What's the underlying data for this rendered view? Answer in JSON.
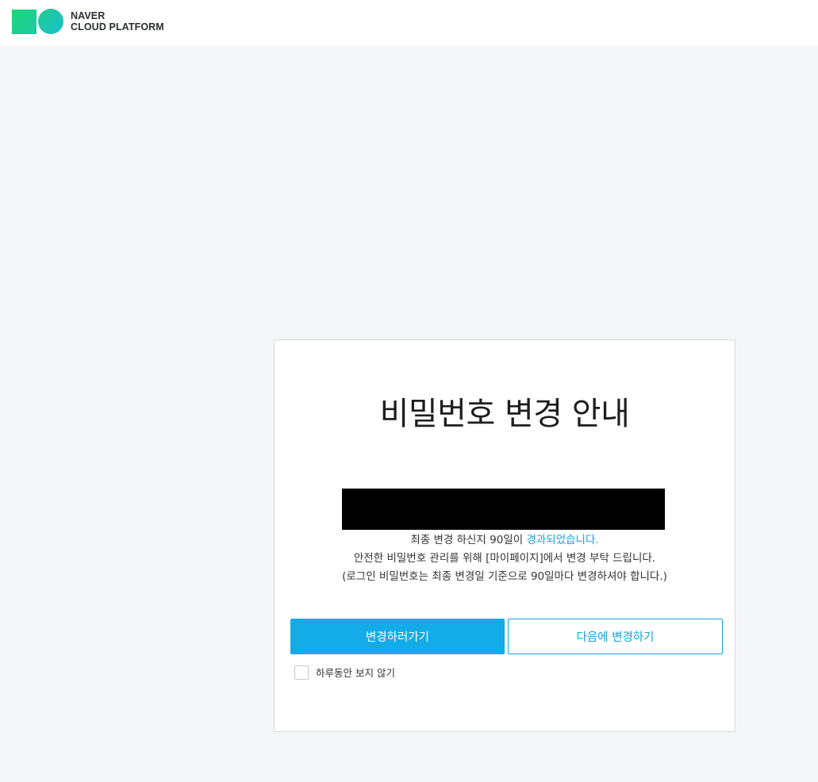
{
  "brand": {
    "line1": "NAVER",
    "line2": "CLOUD PLATFORM",
    "colors": {
      "green": "#1fd67a",
      "teal": "#18c2cf"
    }
  },
  "dialog": {
    "title": "비밀번호 변경 안내",
    "message_line1_prefix": "최종 변경 하신지 90일이 ",
    "message_line1_highlight": "경과되었습니다.",
    "message_line2": "안전한 비밀번호 관리를 위해 [마이페이지]에서 변경 부탁 드립니다.",
    "message_line3": "(로그인 비밀번호는 최종 변경일 기준으로 90일마다 변경하셔야 합니다.)",
    "primary_button": "변경하러가기",
    "secondary_button": "다음에 변경하기",
    "checkbox_label": "하루동안 보지 않기",
    "checkbox_checked": false,
    "accent_color": "#14ace8"
  }
}
